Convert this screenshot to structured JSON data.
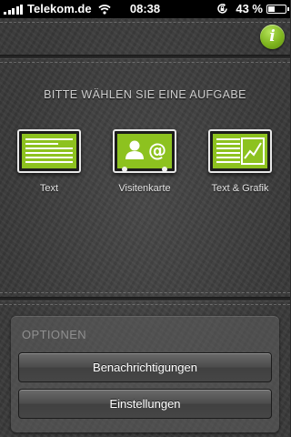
{
  "status_bar": {
    "carrier": "Telekom.de",
    "time": "08:38",
    "battery_percent_label": "43 %",
    "battery_level": 0.43
  },
  "main": {
    "heading": "BITTE WÄHLEN SIE EINE AUFGABE",
    "tasks": [
      {
        "label": "Text",
        "icon": "text-lines-icon"
      },
      {
        "label": "Visitenkarte",
        "icon": "business-card-icon"
      },
      {
        "label": "Text & Grafik",
        "icon": "text-graph-icon"
      }
    ]
  },
  "info_button": {
    "label": "i"
  },
  "options": {
    "title": "OPTIONEN",
    "buttons": [
      {
        "label": "Benachrichtigungen"
      },
      {
        "label": "Einstellungen"
      }
    ]
  },
  "colors": {
    "accent_green": "#8dc21f",
    "background": "#3a3a3a"
  }
}
